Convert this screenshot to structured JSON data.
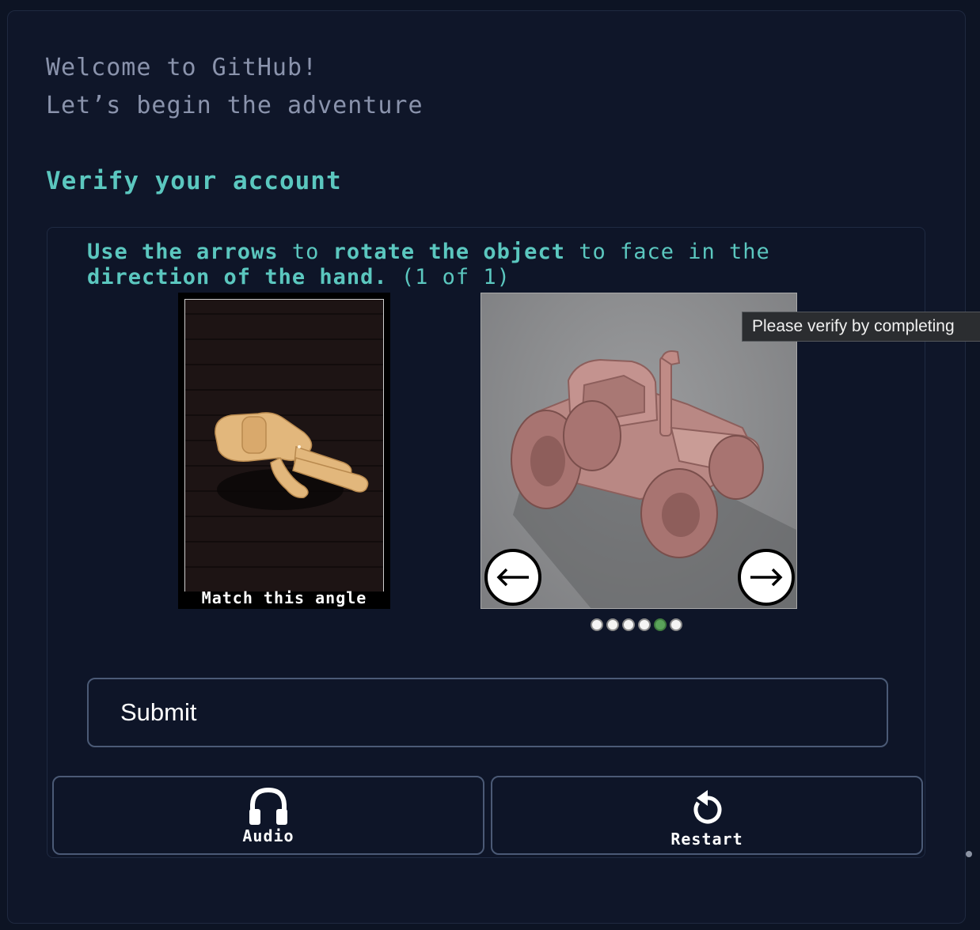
{
  "welcome": {
    "line1": "Welcome to GitHub!",
    "line2": "Let’s begin the adventure"
  },
  "verify": {
    "title": "Verify your account"
  },
  "captcha": {
    "instruction_parts": [
      {
        "text": "Use the arrows",
        "bold": true
      },
      {
        "text": " to ",
        "bold": false
      },
      {
        "text": "rotate the object",
        "bold": true
      },
      {
        "text": " to face in the ",
        "bold": false
      },
      {
        "text": "direction of the hand.",
        "bold": true
      },
      {
        "text": " (1 of 1)",
        "bold": false
      }
    ],
    "reference_label": "Match this angle",
    "left_arrow_icon": "arrow-left-icon",
    "right_arrow_icon": "arrow-right-icon",
    "progress": {
      "total": 6,
      "active_index": 4
    },
    "tooltip": "Please verify by completing"
  },
  "actions": {
    "submit_label": "Submit",
    "audio_label": "Audio",
    "audio_icon": "headphones-icon",
    "restart_label": "Restart",
    "restart_icon": "restart-icon"
  },
  "colors": {
    "accent": "#5bc7bf",
    "background": "#0f1629",
    "muted_text": "#8a93ac",
    "active_dot": "#5aa35a"
  }
}
